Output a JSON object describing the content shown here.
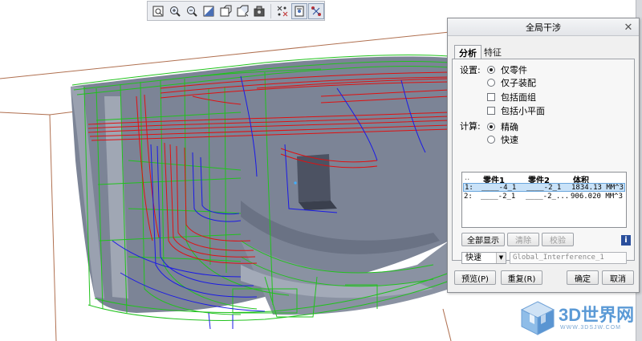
{
  "toolbar": {
    "icons": [
      "zoom-fit-icon",
      "zoom-in-icon",
      "zoom-out-icon",
      "shade-icon",
      "spin-icon",
      "view-orient-icon",
      "render-icon",
      "datum-display-icon",
      "spin-center-icon",
      "annotation-icon"
    ]
  },
  "dialog": {
    "title": "全局干涉",
    "tabs": [
      {
        "label": "分析"
      },
      {
        "label": "特征"
      }
    ],
    "settings_label": "设置:",
    "settings_options": [
      {
        "label": "仅零件",
        "selected": true
      },
      {
        "label": "仅子装配",
        "selected": false
      }
    ],
    "checkboxes": [
      {
        "label": "包括面组",
        "checked": false
      },
      {
        "label": "包括小平面",
        "checked": false
      }
    ],
    "compute_label": "计算:",
    "compute_options": [
      {
        "label": "精确",
        "selected": true
      },
      {
        "label": "快速",
        "selected": false
      }
    ],
    "results": {
      "columns": [
        "零件1",
        "零件2",
        "体积"
      ],
      "header_prefix": "..",
      "rows": [
        {
          "index": "1:",
          "part1": "____-4_1",
          "part2": "____-2_1",
          "volume": "1834.13 MM^3",
          "selected": true
        },
        {
          "index": "2:",
          "part1": "____-2_1",
          "part2": "____-2_...",
          "volume": "906.020 MM^3",
          "selected": false
        }
      ]
    },
    "buttons": {
      "show_all": "全部显示",
      "clear": "清除",
      "verify": "校验",
      "info": "i",
      "preview": "预览(P)",
      "repeat": "重复(R)",
      "ok": "确定",
      "cancel": "取消"
    },
    "mode_select": {
      "value": "快速"
    },
    "name_input": {
      "value": "Global_Interference_1"
    }
  },
  "watermark": {
    "text": "3D世界网",
    "url": "WWW.3DSJW.COM"
  },
  "colors": {
    "dialog_bg": "#f0f0f0",
    "selection": "#c9e2f8",
    "model_body": "#7b8394",
    "wire_green": "#21c21d",
    "wire_red": "#e01010",
    "wire_blue": "#1a1ae6",
    "frame_line": "#b07050",
    "watermark": "#5b9ad6"
  }
}
